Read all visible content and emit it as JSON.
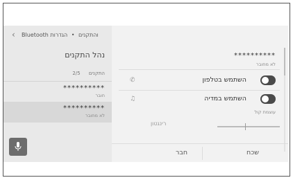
{
  "header": {
    "breadcrumb_bluetooth": "Bluetooth והתקנים",
    "breadcrumb_separator": "•",
    "breadcrumb_settings": "הגדרות",
    "back_icon": "chevron-left-icon"
  },
  "left_panel": {
    "title": "נהל התקנים",
    "list_header": {
      "label": "התקנים",
      "count": "2/5"
    },
    "devices": [
      {
        "name": "**********",
        "status": "חובר"
      },
      {
        "name": "**********",
        "status": "לא מחובר"
      }
    ],
    "mic_icon": "microphone-icon"
  },
  "right_panel": {
    "device_name": "**********",
    "device_status": "לא מחובר",
    "toggles": [
      {
        "label": "השתמש בטלפון",
        "icon": "phone-icon",
        "on": true
      },
      {
        "label": "השתמש במדיה",
        "icon": "music-note-icon",
        "on": true
      }
    ],
    "volume_label": "עוצמת קול",
    "ringtone_label": "רינגטון",
    "actions": {
      "connect": "חבר",
      "forget": "שכח"
    }
  },
  "colors": {
    "toggle_on": "#4a4a4a",
    "panel_bg": "#eeeeee",
    "selected_row": "#d8d8d8"
  }
}
